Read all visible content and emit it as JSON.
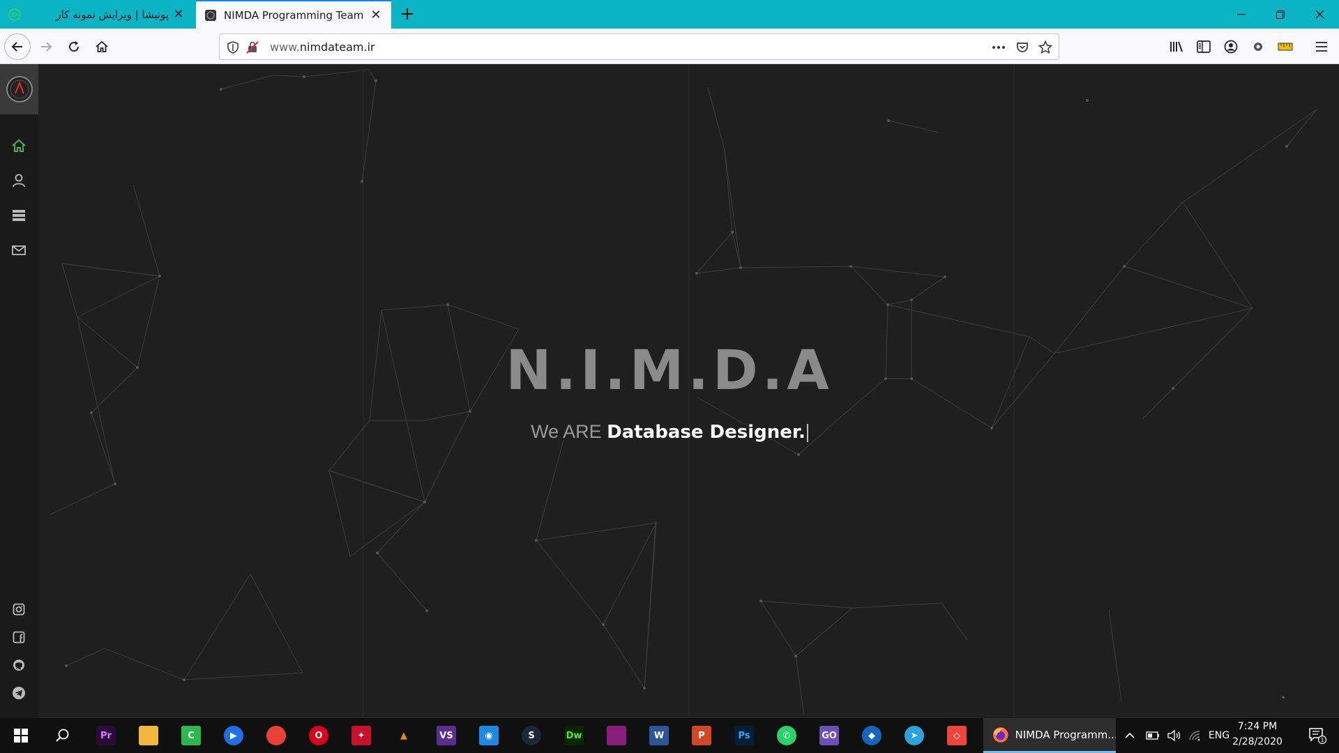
{
  "browser": {
    "tabs": [
      {
        "title": "پونیشا | ویرایش نمونه کار",
        "active": false
      },
      {
        "title": "NIMDA Programming Team",
        "active": true
      }
    ],
    "url_prefix": "www.",
    "url_domain": "nimdateam.ir"
  },
  "hero": {
    "title": "N.I.M.D.A",
    "subtitle_prefix": "We ARE ",
    "subtitle_strong": "Database Designer."
  },
  "sidebar": {
    "nav": [
      "home-icon",
      "user-icon",
      "stack-icon",
      "mail-icon"
    ],
    "social": [
      "instagram-icon",
      "facebook-icon",
      "github-icon",
      "telegram-icon"
    ],
    "active_color": "#4caf50"
  },
  "taskbar": {
    "pinned": [
      {
        "name": "premiere",
        "label": "Pr",
        "bg": "#2a0a3a",
        "fg": "#e07bff"
      },
      {
        "name": "files",
        "label": "",
        "bg": "#f0b73a",
        "fg": "#000"
      },
      {
        "name": "camtasia",
        "label": "C",
        "bg": "#2db84c",
        "fg": "#fff"
      },
      {
        "name": "media-player",
        "label": "▶",
        "bg": "#1e6fe8",
        "fg": "#fff"
      },
      {
        "name": "chrome",
        "label": "",
        "bg": "#e94235",
        "fg": "#fff"
      },
      {
        "name": "opera",
        "label": "O",
        "bg": "#d9001b",
        "fg": "#fff"
      },
      {
        "name": "app-red",
        "label": "✦",
        "bg": "#c8102e",
        "fg": "#fff"
      },
      {
        "name": "vlc",
        "label": "▲",
        "bg": "#101010",
        "fg": "#f08a00"
      },
      {
        "name": "visual-studio",
        "label": "VS",
        "bg": "#5c2d91",
        "fg": "#fff"
      },
      {
        "name": "screenshot",
        "label": "◉",
        "bg": "#1e88e5",
        "fg": "#fff"
      },
      {
        "name": "steam",
        "label": "S",
        "bg": "#1b2838",
        "fg": "#fff"
      },
      {
        "name": "dreamweaver",
        "label": "Dw",
        "bg": "#072501",
        "fg": "#4af000"
      },
      {
        "name": "winrar",
        "label": "",
        "bg": "#8a1c7c",
        "fg": "#fff"
      },
      {
        "name": "word",
        "label": "W",
        "bg": "#2b579a",
        "fg": "#fff"
      },
      {
        "name": "powerpoint",
        "label": "P",
        "bg": "#d24726",
        "fg": "#fff"
      },
      {
        "name": "photoshop",
        "label": "Ps",
        "bg": "#001e36",
        "fg": "#31a8ff"
      },
      {
        "name": "whatsapp",
        "label": "✆",
        "bg": "#25d366",
        "fg": "#fff"
      },
      {
        "name": "go",
        "label": "GO",
        "bg": "#6b4fbb",
        "fg": "#fff"
      },
      {
        "name": "shield",
        "label": "◆",
        "bg": "#1565c0",
        "fg": "#fff"
      },
      {
        "name": "telegram",
        "label": "➤",
        "bg": "#2aa3de",
        "fg": "#fff"
      },
      {
        "name": "anydesk",
        "label": "◇",
        "bg": "#ef443b",
        "fg": "#fff"
      }
    ],
    "active_window": "NIMDA Programm...",
    "lang": "ENG",
    "time": "7:24 PM",
    "date": "2/28/2020",
    "notifications": "1"
  }
}
